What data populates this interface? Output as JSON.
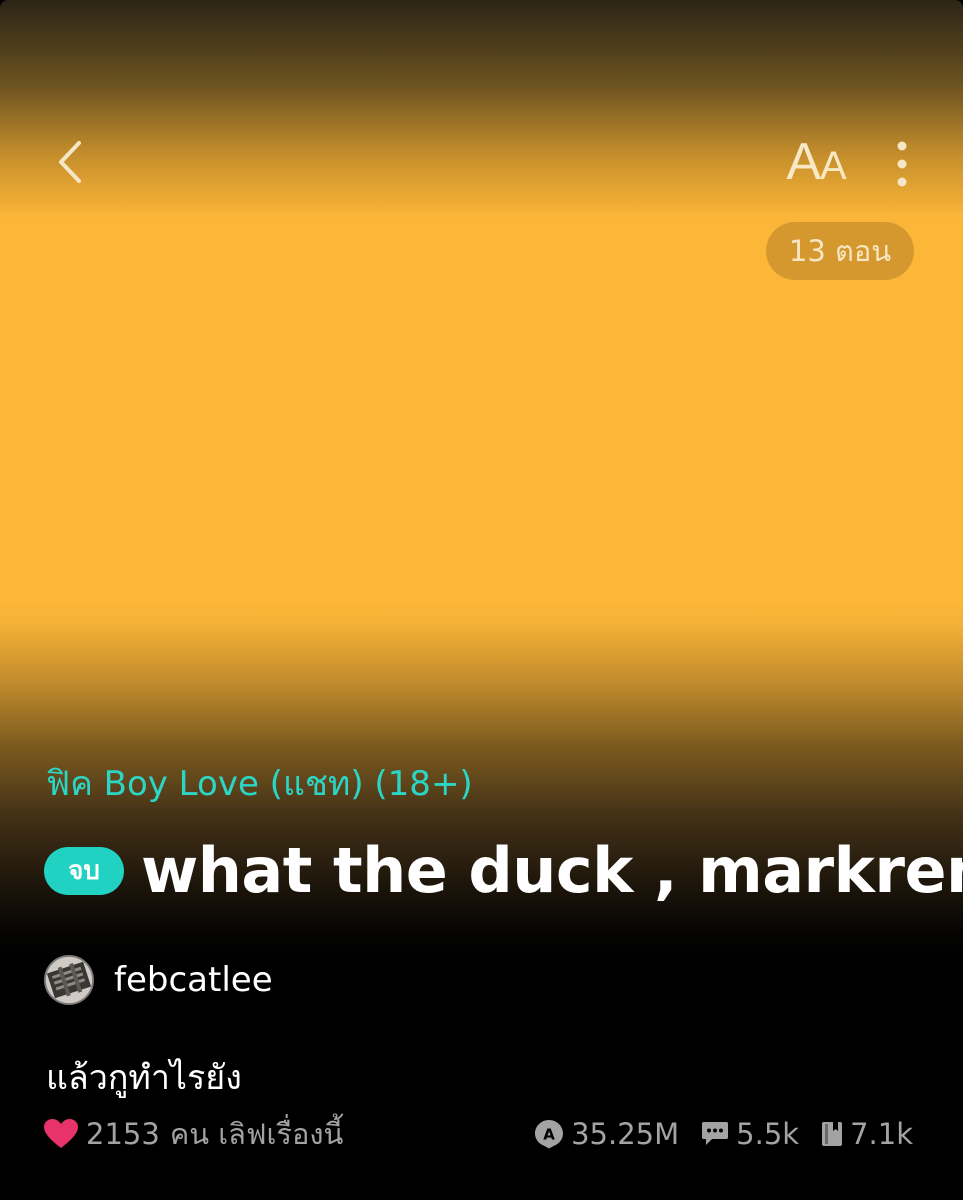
{
  "header": {
    "back_icon": "chevron-left-icon",
    "font_size_label_big": "A",
    "font_size_label_small": "A",
    "more_icon": "vertical-ellipsis-icon",
    "episodes_badge": "13 ตอน"
  },
  "story": {
    "category": "ฟิค Boy Love (แชท) (18+)",
    "status_badge": "จบ",
    "title": "what the duck , markren",
    "author": "febcatlee",
    "description": "แล้วกูทำไรยัง"
  },
  "stats": {
    "love_count": "2153",
    "love_text": "คน เลิฟเรื่องนี้",
    "views": "35.25M",
    "comments": "5.5k",
    "bookmarks": "7.1k"
  },
  "colors": {
    "cover_yellow": "#fdb738",
    "accent_teal": "#21d1c1",
    "heart_pink": "#e8336a",
    "stat_gray": "#a3a3a3"
  }
}
